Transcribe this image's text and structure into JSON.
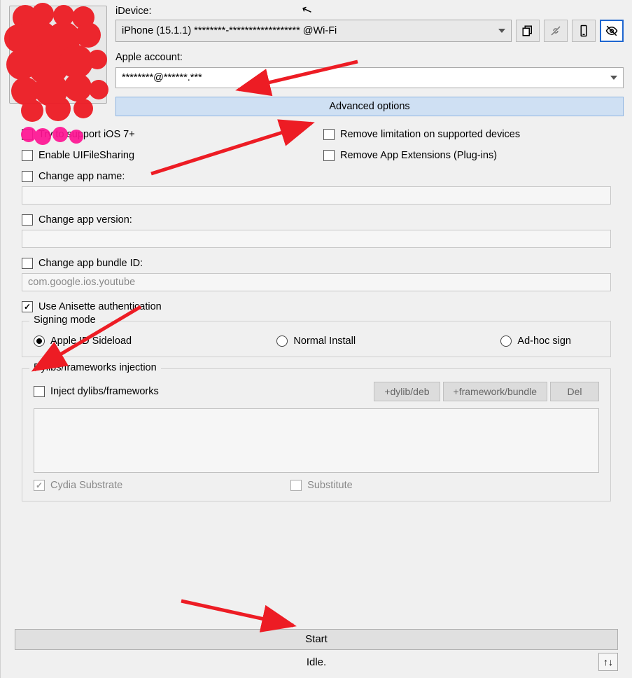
{
  "top": {
    "idevice_label": "iDevice:",
    "device_text": "iPhone (15.1.1) ********-****************** @Wi-Fi",
    "apple_account_label": "Apple account:",
    "apple_account_value": "********@******.***",
    "advanced_options": "Advanced options"
  },
  "checkboxes": {
    "ios7": {
      "label": "Try to support iOS 7+",
      "checked": false
    },
    "remove_limitation": {
      "label": "Remove limitation on supported devices",
      "checked": false
    },
    "uifilesharing": {
      "label": "Enable UIFileSharing",
      "checked": false
    },
    "remove_extensions": {
      "label": "Remove App Extensions (Plug-ins)",
      "checked": false
    },
    "change_name": {
      "label": "Change app name:",
      "checked": false,
      "value": ""
    },
    "change_version": {
      "label": "Change app version:",
      "checked": false,
      "value": ""
    },
    "change_bundle": {
      "label": "Change app bundle ID:",
      "checked": false,
      "value": "com.google.ios.youtube"
    },
    "anisette": {
      "label": "Use Anisette authentication",
      "checked": true
    }
  },
  "signing": {
    "title": "Signing mode",
    "options": [
      "Apple ID Sideload",
      "Normal Install",
      "Ad-hoc sign"
    ],
    "selected": 0
  },
  "dylib": {
    "title": "Dylibs/frameworks injection",
    "inject_label": "Inject dylibs/frameworks",
    "btn_dylib": "+dylib/deb",
    "btn_fw": "+framework/bundle",
    "btn_del": "Del",
    "cydia_label": "Cydia Substrate",
    "substitute_label": "Substitute"
  },
  "bottom": {
    "start": "Start",
    "status": "Idle.",
    "sort_icon": "↑↓"
  },
  "icons": {
    "copy": "copy-icon",
    "unlink": "unlink-icon",
    "device": "device-icon",
    "eyeoff": "eye-off-icon"
  }
}
